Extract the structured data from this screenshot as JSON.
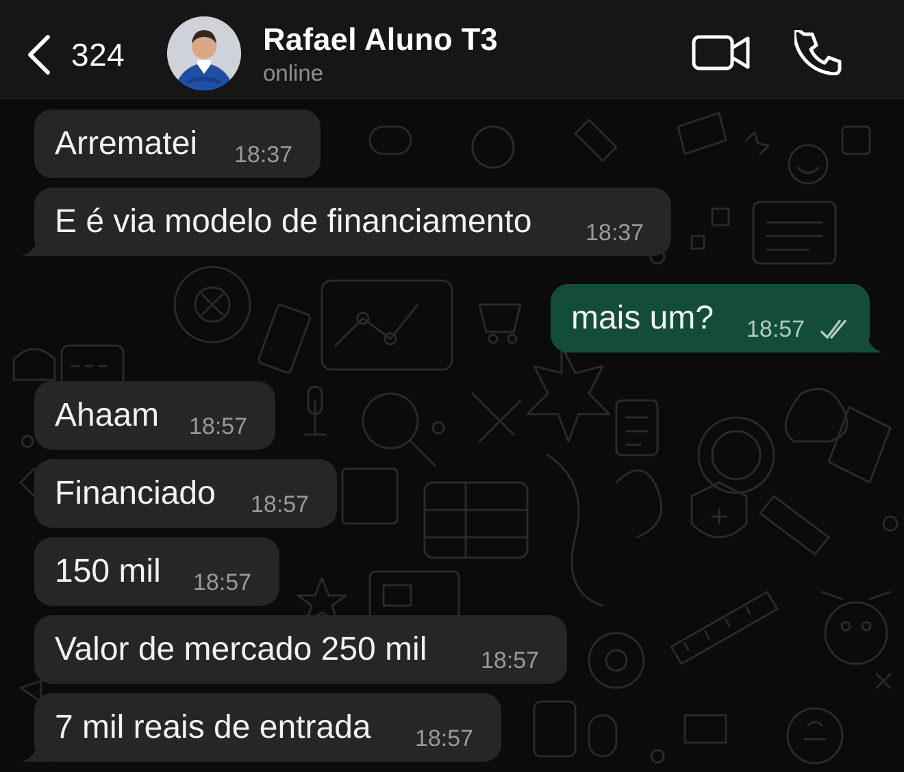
{
  "header": {
    "back_count": "324",
    "contact_name": "Rafael Aluno T3",
    "contact_status": "online"
  },
  "icons": {
    "back": "chevron-left-icon",
    "video": "video-camera-icon",
    "call": "phone-icon",
    "read": "double-check-icon"
  },
  "colors": {
    "incoming_bubble": "#262628",
    "outgoing_bubble": "#144d37",
    "background": "#0b0b0b",
    "header": "#161616"
  },
  "messages": [
    {
      "direction": "in",
      "text": "Arrematei",
      "time": "18:37"
    },
    {
      "direction": "in",
      "text": "E é via modelo de financiamento",
      "time": "18:37"
    },
    {
      "direction": "out",
      "text": "mais um?",
      "time": "18:57",
      "status": "read"
    },
    {
      "direction": "in",
      "text": "Ahaam",
      "time": "18:57"
    },
    {
      "direction": "in",
      "text": "Financiado",
      "time": "18:57"
    },
    {
      "direction": "in",
      "text": "150 mil",
      "time": "18:57"
    },
    {
      "direction": "in",
      "text": "Valor de mercado 250 mil",
      "time": "18:57"
    },
    {
      "direction": "in",
      "text": "7 mil reais de entrada",
      "time": "18:57"
    }
  ]
}
